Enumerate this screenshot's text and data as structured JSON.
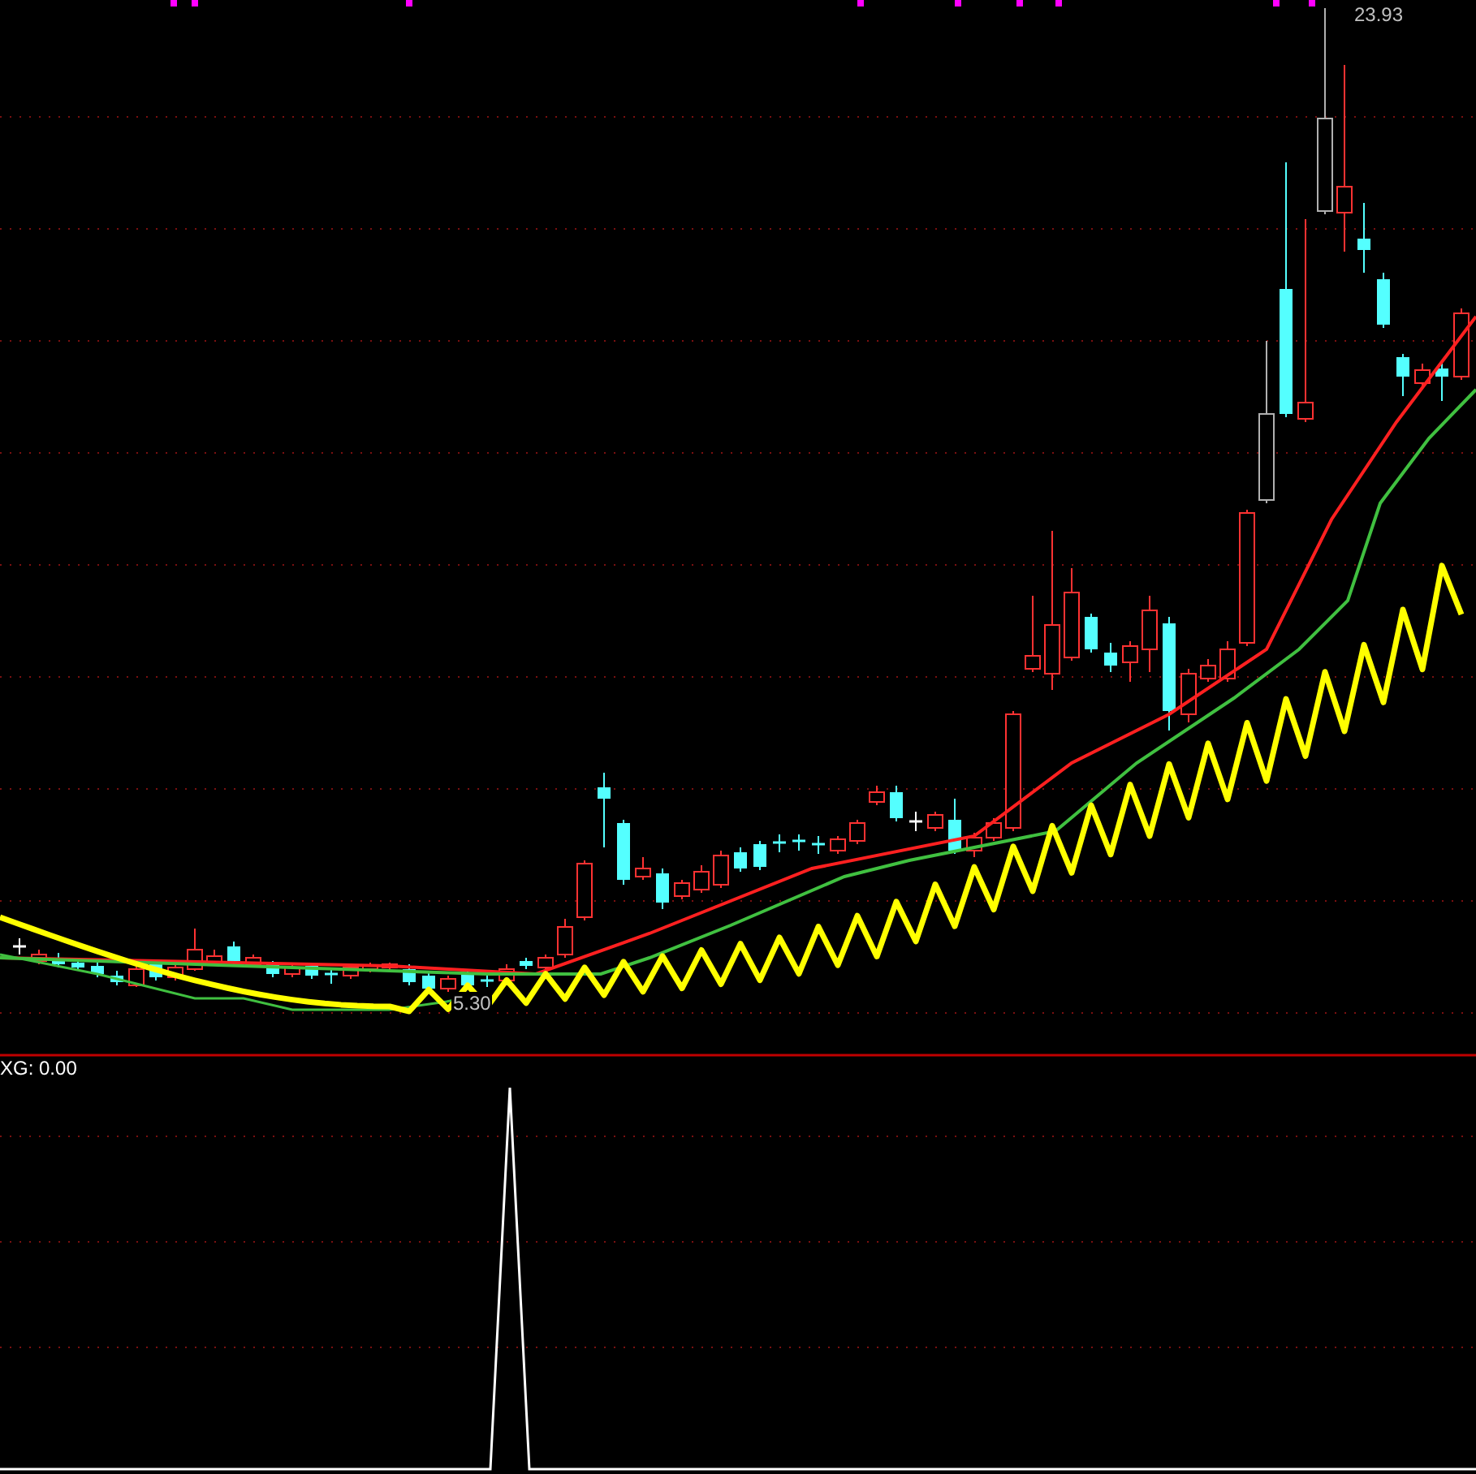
{
  "price_chart": {
    "high_label": "23.93",
    "low_label": "5.30"
  },
  "indicator_panel": {
    "title": "XG: 0.00"
  }
}
